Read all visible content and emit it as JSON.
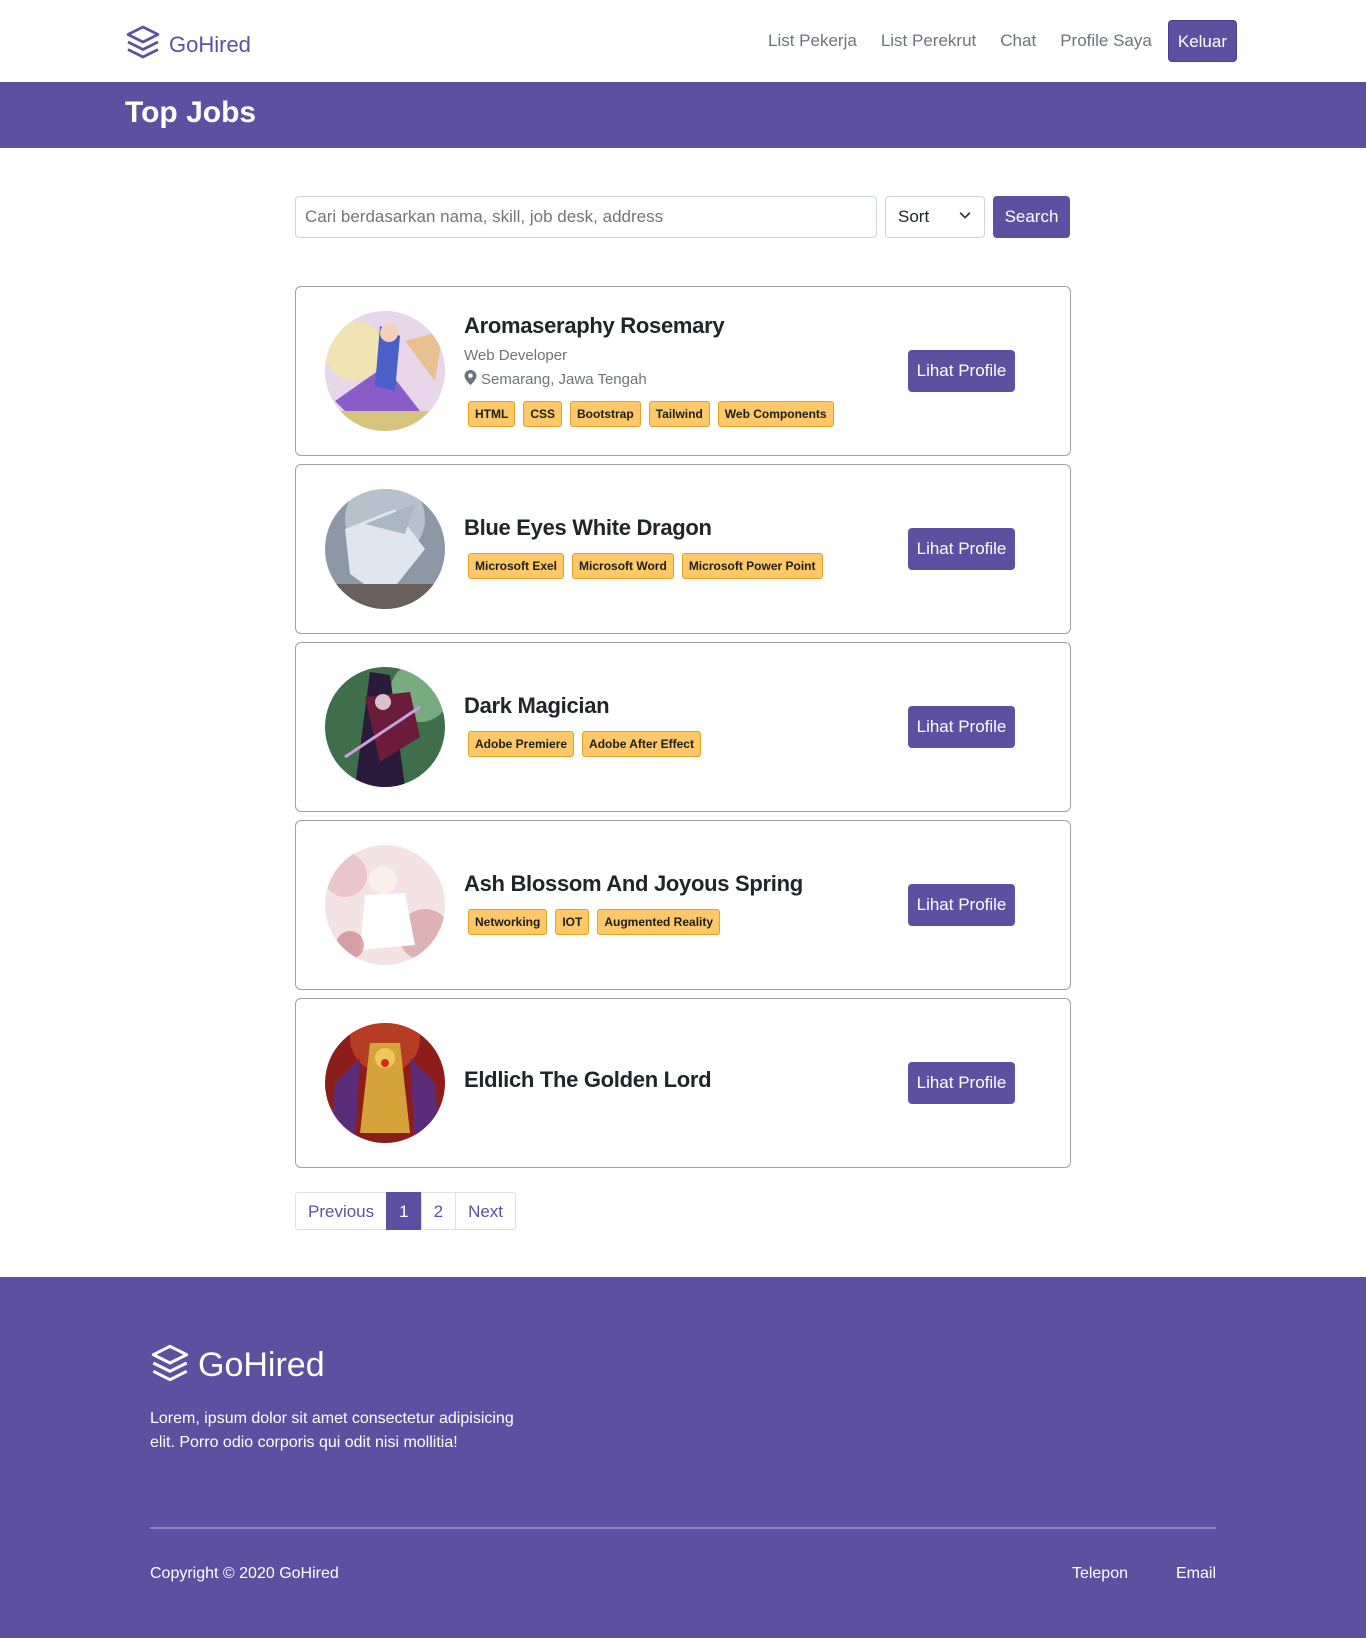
{
  "brand": {
    "name": "GoHired",
    "icon": "layers-icon"
  },
  "nav": {
    "links": [
      "List Pekerja",
      "List Perekrut",
      "Chat",
      "Profile Saya"
    ],
    "logout": "Keluar"
  },
  "banner": {
    "title": "Top Jobs"
  },
  "search": {
    "placeholder": "Cari berdasarkan nama, skill, job desk, address",
    "sort_label": "Sort",
    "button": "Search"
  },
  "cards": [
    {
      "name": "Aromaseraphy Rosemary",
      "job": "Web Developer",
      "location": "Semarang, Jawa Tengah",
      "skills": [
        "HTML",
        "CSS",
        "Bootstrap",
        "Tailwind",
        "Web Components"
      ],
      "button": "Lihat Profile"
    },
    {
      "name": "Blue Eyes White Dragon",
      "skills": [
        "Microsoft Exel",
        "Microsoft Word",
        "Microsoft Power Point"
      ],
      "button": "Lihat Profile"
    },
    {
      "name": "Dark Magician",
      "skills": [
        "Adobe Premiere",
        "Adobe After Effect"
      ],
      "button": "Lihat Profile"
    },
    {
      "name": "Ash Blossom And Joyous Spring",
      "skills": [
        "Networking",
        "IOT",
        "Augmented Reality"
      ],
      "button": "Lihat Profile"
    },
    {
      "name": "Eldlich The Golden Lord",
      "skills": [],
      "button": "Lihat Profile"
    }
  ],
  "pagination": {
    "previous": "Previous",
    "pages": [
      "1",
      "2"
    ],
    "active": "1",
    "next": "Next"
  },
  "footer": {
    "brand": "GoHired",
    "description": "Lorem, ipsum dolor sit amet consectetur adipisicing elit. Porro odio corporis qui odit nisi mollitia!",
    "copyright": "Copyright © 2020 GoHired",
    "links": [
      "Telepon",
      "Email"
    ]
  },
  "colors": {
    "primary": "#5e50a1",
    "tag": "#fcc868"
  }
}
